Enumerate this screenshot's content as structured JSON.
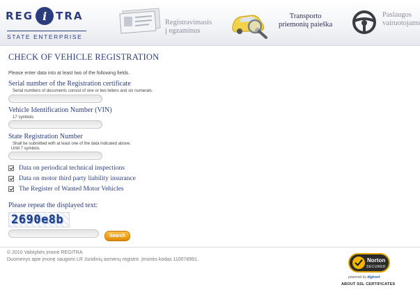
{
  "header": {
    "logo_left": "REG",
    "logo_mid": "i",
    "logo_right": "TRA",
    "logo_sub": "STATE ENTERPRISE",
    "nav": [
      {
        "line1": "Registravimasis",
        "line2": "į egzaminus",
        "icon": "license-card-icon",
        "active": false
      },
      {
        "line1": "Transporto",
        "line2": "priemonių paieška",
        "icon": "car-search-icon",
        "active": true
      },
      {
        "line1": "Paslaugos",
        "line2": "vairuotojams",
        "icon": "steering-wheel-icon",
        "active": false
      }
    ]
  },
  "form": {
    "title": "CHECK OF VEHICLE REGISTRATION",
    "intro": "Please enter data into at least two of the following fields.",
    "serial": {
      "label": "Serial number of the Registration certificate",
      "hint": "Serial numbers of documents consist of one or two letters and six numerals.",
      "value": ""
    },
    "vin": {
      "label": "Vehicle Identification Number (VIN)",
      "hint": "17 symbols",
      "value": ""
    },
    "plate": {
      "label": "State Registration Number",
      "hint1": "Shall be submitted with at least one of the data indicated above.",
      "hint2": "Until 7 symbols",
      "value": ""
    },
    "checks": [
      {
        "label": "Data on periodical technical inspections",
        "checked": true
      },
      {
        "label": "Data on motor third party liability insurance",
        "checked": true
      },
      {
        "label": "The Register of Wanted Motor Vehicles",
        "checked": true
      }
    ],
    "captcha_label": "Please repeat the displayed text:",
    "captcha_text": "2690e8b",
    "captcha_value": "",
    "search_label": "Search"
  },
  "footer": {
    "line1": "© 2010 Valstybės įmonė REGITRA",
    "line2": "Duomenys apie įmonę saugomi LR Juridinių asmenų registre. Įmonės kodas 110078991.",
    "norton_name": "Norton",
    "norton_secured": "SECURED",
    "norton_powered": "powered by",
    "norton_digicert": "digicert",
    "ssl_link": "ABOUT SSL CERTIFICATES"
  },
  "colors": {
    "brand": "#2c3d7e",
    "button": "#f0a21a"
  }
}
